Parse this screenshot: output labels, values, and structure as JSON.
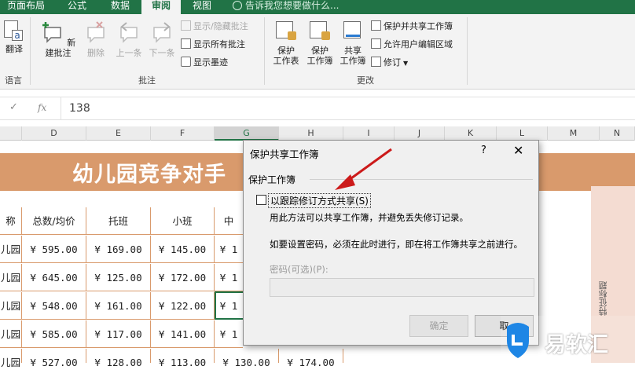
{
  "tabs": [
    {
      "label": "页面布局",
      "active": false
    },
    {
      "label": "公式",
      "active": false
    },
    {
      "label": "数据",
      "active": false
    },
    {
      "label": "审阅",
      "active": true
    },
    {
      "label": "视图",
      "active": false
    }
  ],
  "tell_me": "告诉我您想要做什么...",
  "ribbon": {
    "translate_label": "翻译",
    "language_group": "语言",
    "new_comment": "新建批注",
    "delete": "删除",
    "previous": "上一条",
    "next": "下一条",
    "show_hide_comment": "显示/隐藏批注",
    "show_all_comments": "显示所有批注",
    "show_ink": "显示墨迹",
    "comments_group": "批注",
    "protect_sheet_1": "保护",
    "protect_sheet_2": "工作表",
    "protect_workbook_1": "保护",
    "protect_workbook_2": "工作簿",
    "share_workbook_1": "共享",
    "share_workbook_2": "工作簿",
    "protect_share": "保护并共享工作簿",
    "allow_edit_ranges": "允许用户编辑区域",
    "track_changes": "修订",
    "changes_group": "更改"
  },
  "formula_bar": {
    "value": "138"
  },
  "columns": [
    "D",
    "E",
    "F",
    "G",
    "H",
    "I",
    "J",
    "K",
    "L",
    "M",
    "N"
  ],
  "sheet": {
    "title": "幼儿园竞争对手",
    "headers": [
      "称",
      "总数/均价",
      "托班",
      "小班",
      "中"
    ],
    "rows": [
      [
        "儿园",
        "¥ 595.00",
        "¥ 169.00",
        "¥ 145.00",
        "¥ 1"
      ],
      [
        "儿园",
        "¥ 645.00",
        "¥ 125.00",
        "¥ 172.00",
        "¥ 1"
      ],
      [
        "儿园",
        "¥ 548.00",
        "¥ 161.00",
        "¥ 122.00",
        "¥ 1"
      ],
      [
        "儿园",
        "¥ 585.00",
        "¥ 117.00",
        "¥ 141.00",
        "¥ 1"
      ],
      [
        "儿园",
        "¥ 527.00",
        "¥ 128.00",
        "¥ 113.00",
        "¥ 130.00",
        "¥ 174.00"
      ]
    ],
    "side_label": "特征标题"
  },
  "dialog": {
    "title": "保护共享工作簿",
    "help": "?",
    "close": "✕",
    "section": "保护工作簿",
    "checkbox_label": "以跟踪修订方式共享(S)",
    "checkbox_checked": false,
    "desc1": "用此方法可以共享工作簿，并避免丢失修订记录。",
    "desc2": "如要设置密码，必须在此时进行，即在将工作簿共享之前进行。",
    "password_label": "密码(可选)(P):",
    "password_value": "",
    "ok": "确定",
    "cancel": "取"
  },
  "watermark": {
    "text": "易软汇"
  },
  "colors": {
    "brand_green": "#217346",
    "title_band": "#d99a6c",
    "arrow": "#cc1a1a",
    "watermark_blue": "#1e86e5"
  }
}
